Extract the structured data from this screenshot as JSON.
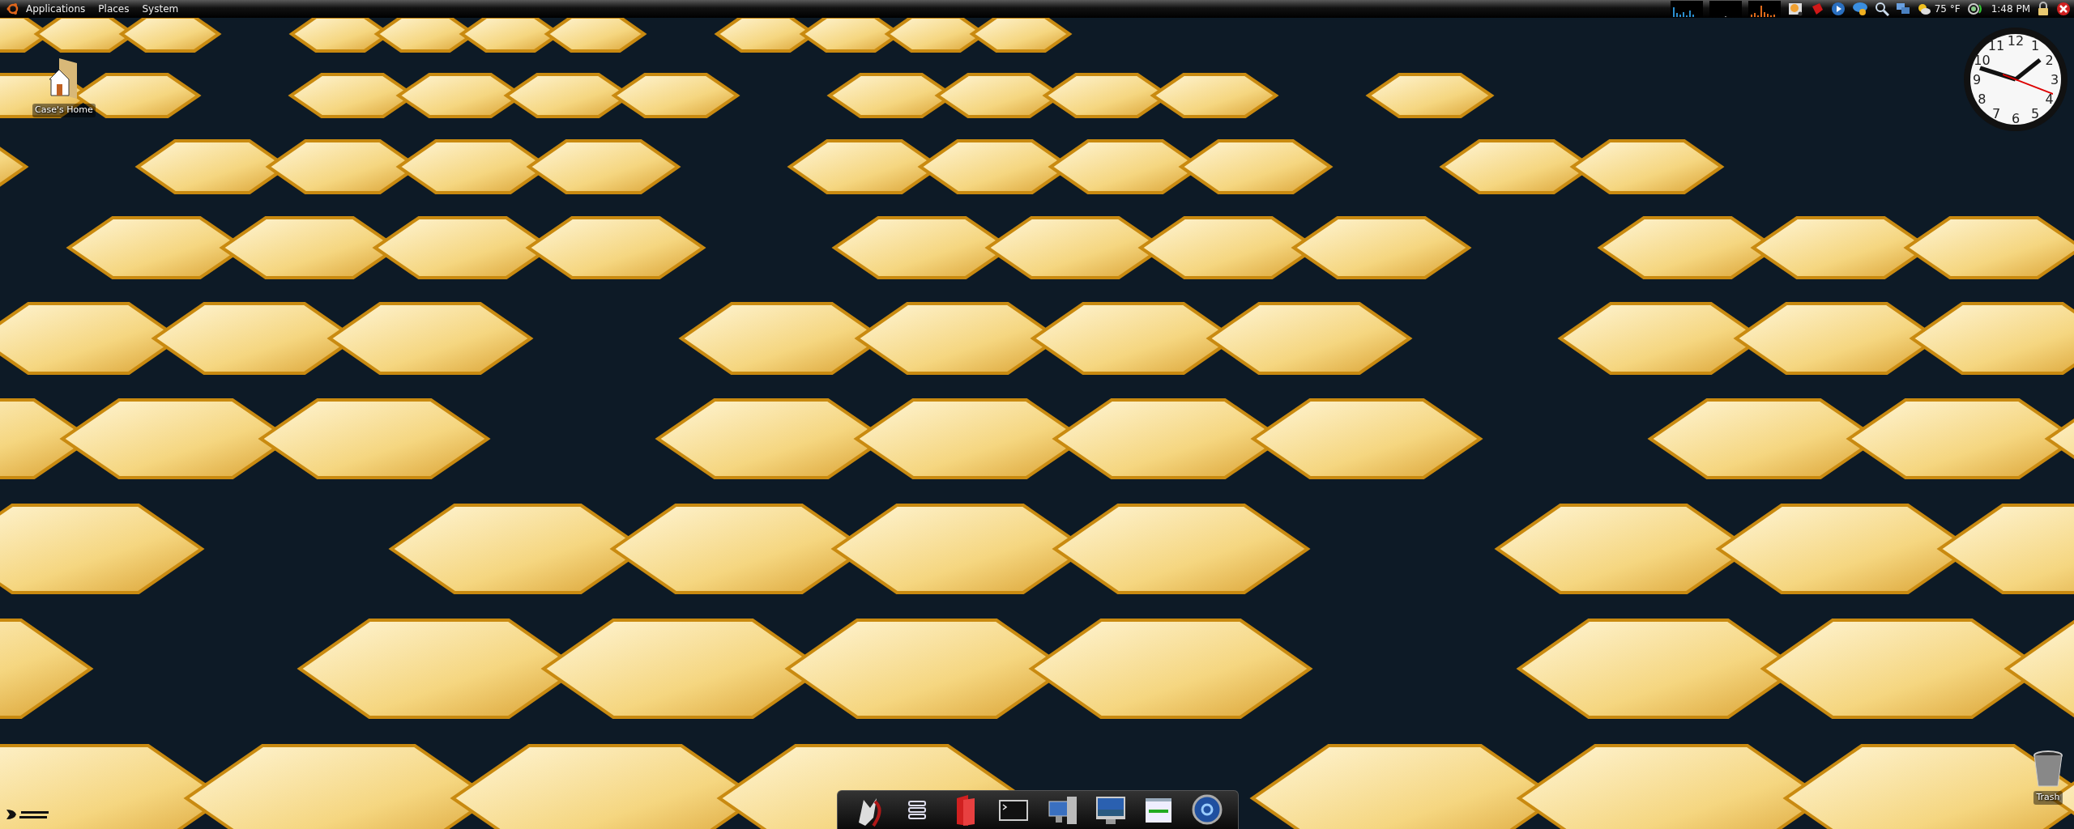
{
  "top_panel": {
    "menus": [
      "Applications",
      "Places",
      "System"
    ],
    "weather": "75 °F",
    "time": "1:48 PM"
  },
  "desktop_icons": [
    {
      "kind": "home",
      "label": "Case's Home"
    },
    {
      "kind": "trash",
      "label": "Trash"
    }
  ],
  "clock": {
    "numeral_rows": [
      [
        "11",
        "12",
        "1"
      ],
      [
        "10",
        "2"
      ],
      [
        "9",
        "3"
      ],
      [
        "8",
        "4"
      ],
      [
        "7",
        "6",
        "5"
      ]
    ]
  }
}
